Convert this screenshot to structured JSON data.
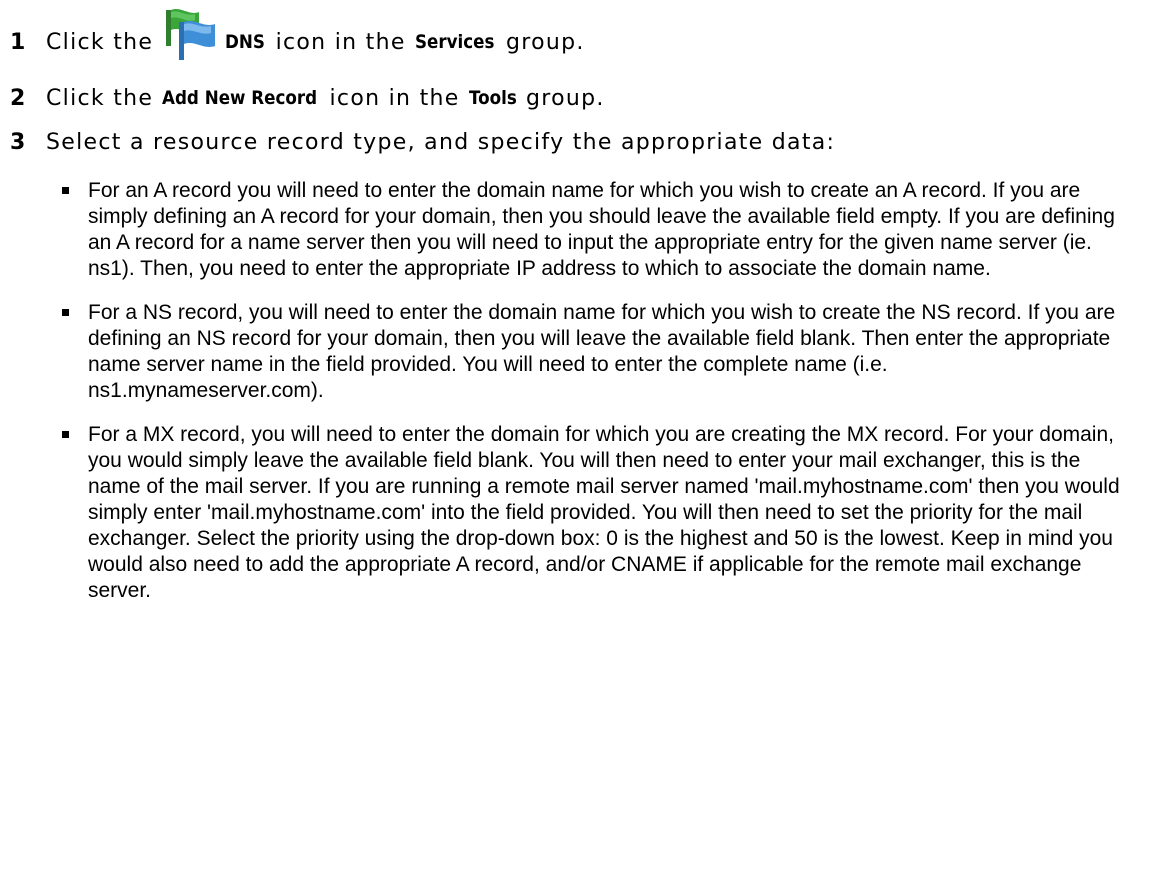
{
  "steps": [
    {
      "number": "1",
      "before": "Click the",
      "icon": "dns-flag-icon",
      "term": "DNS",
      "middle": "icon in the",
      "group": "Services",
      "after": "group."
    },
    {
      "number": "2",
      "before": "Click the",
      "term": "Add New Record",
      "middle": "icon in the",
      "group": "Tools",
      "after": "group."
    },
    {
      "number": "3",
      "text": "Select a resource record type, and specify the appropriate data:"
    }
  ],
  "bullets": [
    "For an A record you will need to enter the domain name for which you wish to create an A record. If you are simply defining an A record for your domain, then you should leave the available field empty. If you are defining an A record for a name server then you will need to input the appropriate entry for the given name server (ie. ns1). Then, you need to enter the appropriate IP address to which to associate the domain name.",
    "For a NS record, you will need to enter the domain name for which you wish to create the NS record. If you are defining an NS record for your domain, then you will leave the available field blank. Then enter the appropriate name server name in the field provided. You will need to enter the complete name (i.e. ns1.mynameserver.com).",
    "For a MX record, you will need to enter the domain for which you are creating the MX record. For your domain, you would simply leave the available field blank. You will then need to enter your mail exchanger, this is the name of the mail server. If you are running a remote mail server named 'mail.myhostname.com' then you would simply enter 'mail.myhostname.com' into the field provided. You will then need to set the priority for the mail exchanger. Select the priority using the drop-down box: 0 is the highest and 50 is the lowest. Keep in mind you would also need to add the appropriate A record, and/or CNAME if applicable for the remote mail exchange server."
  ],
  "colors": {
    "text": "#000000",
    "background": "#ffffff",
    "flag_green": "#3aa63a",
    "flag_blue": "#3f8fd8"
  }
}
